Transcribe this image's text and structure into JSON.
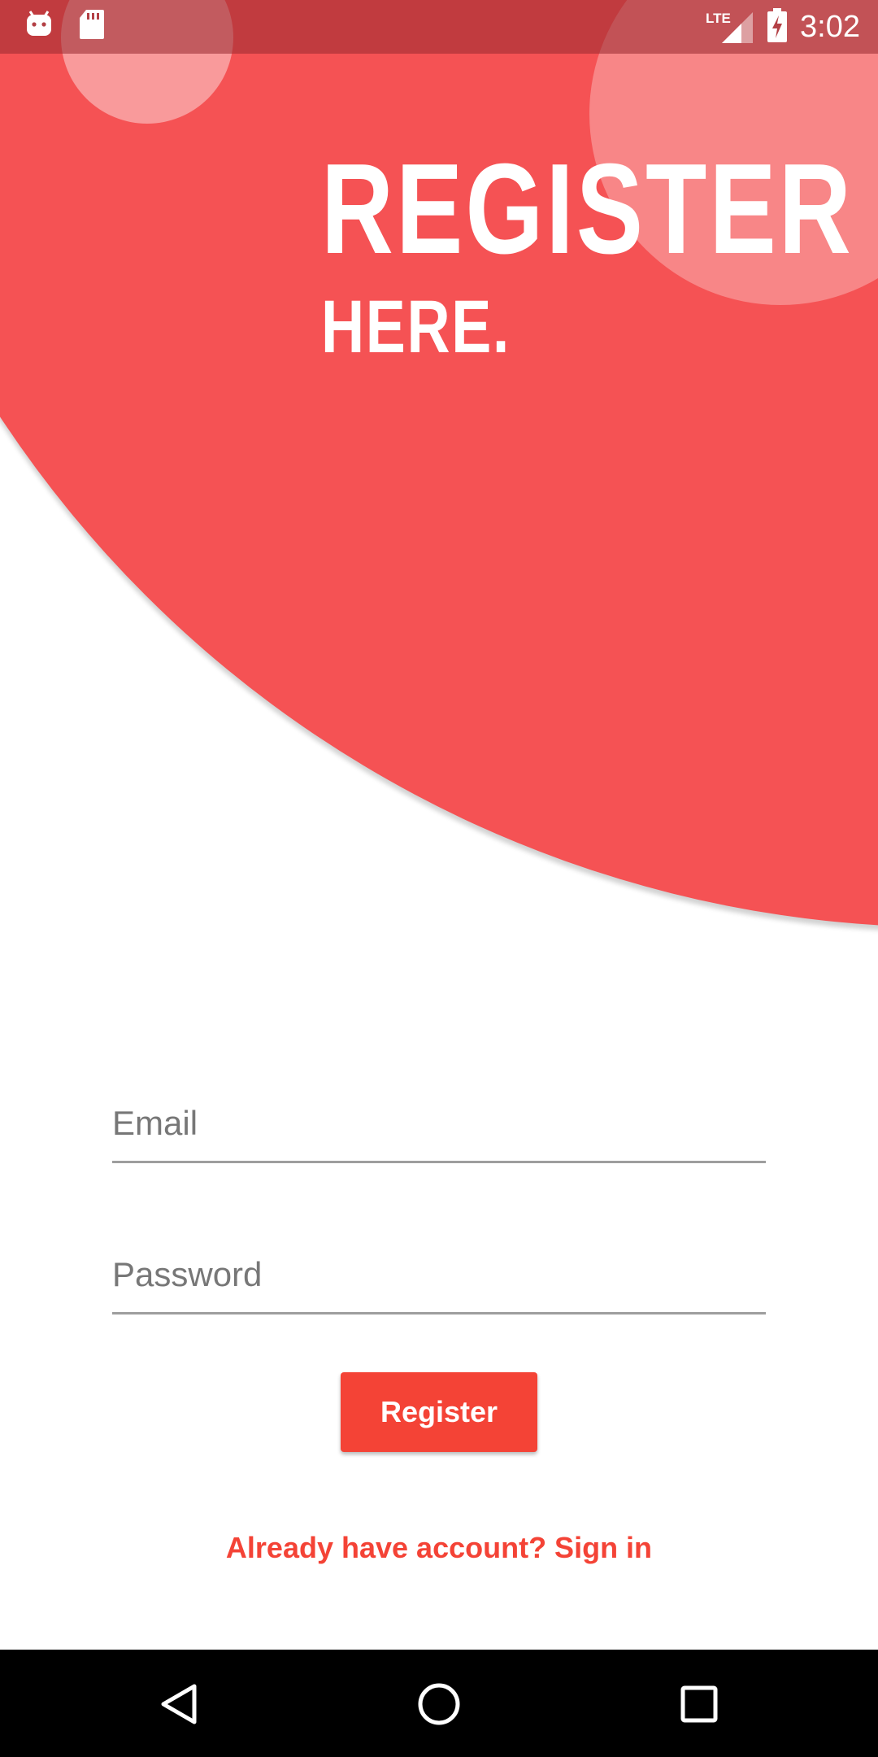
{
  "status_bar": {
    "time": "3:02",
    "network": "LTE",
    "icons": [
      "android-debug-icon",
      "sd-card-icon",
      "lte-signal-icon",
      "battery-charging-icon"
    ]
  },
  "header": {
    "title": "REGISTER",
    "subtitle": "HERE."
  },
  "form": {
    "email_placeholder": "Email",
    "email_value": "",
    "password_placeholder": "Password",
    "password_value": "",
    "register_label": "Register",
    "signin_link": "Already have account? Sign in"
  },
  "navigation": {
    "icons": [
      "back-icon",
      "home-icon",
      "recents-icon"
    ]
  },
  "colors": {
    "accent": "#F44336",
    "circle": "#F55254",
    "status_bar": "#B03A3F",
    "nav_bar": "#000000"
  }
}
